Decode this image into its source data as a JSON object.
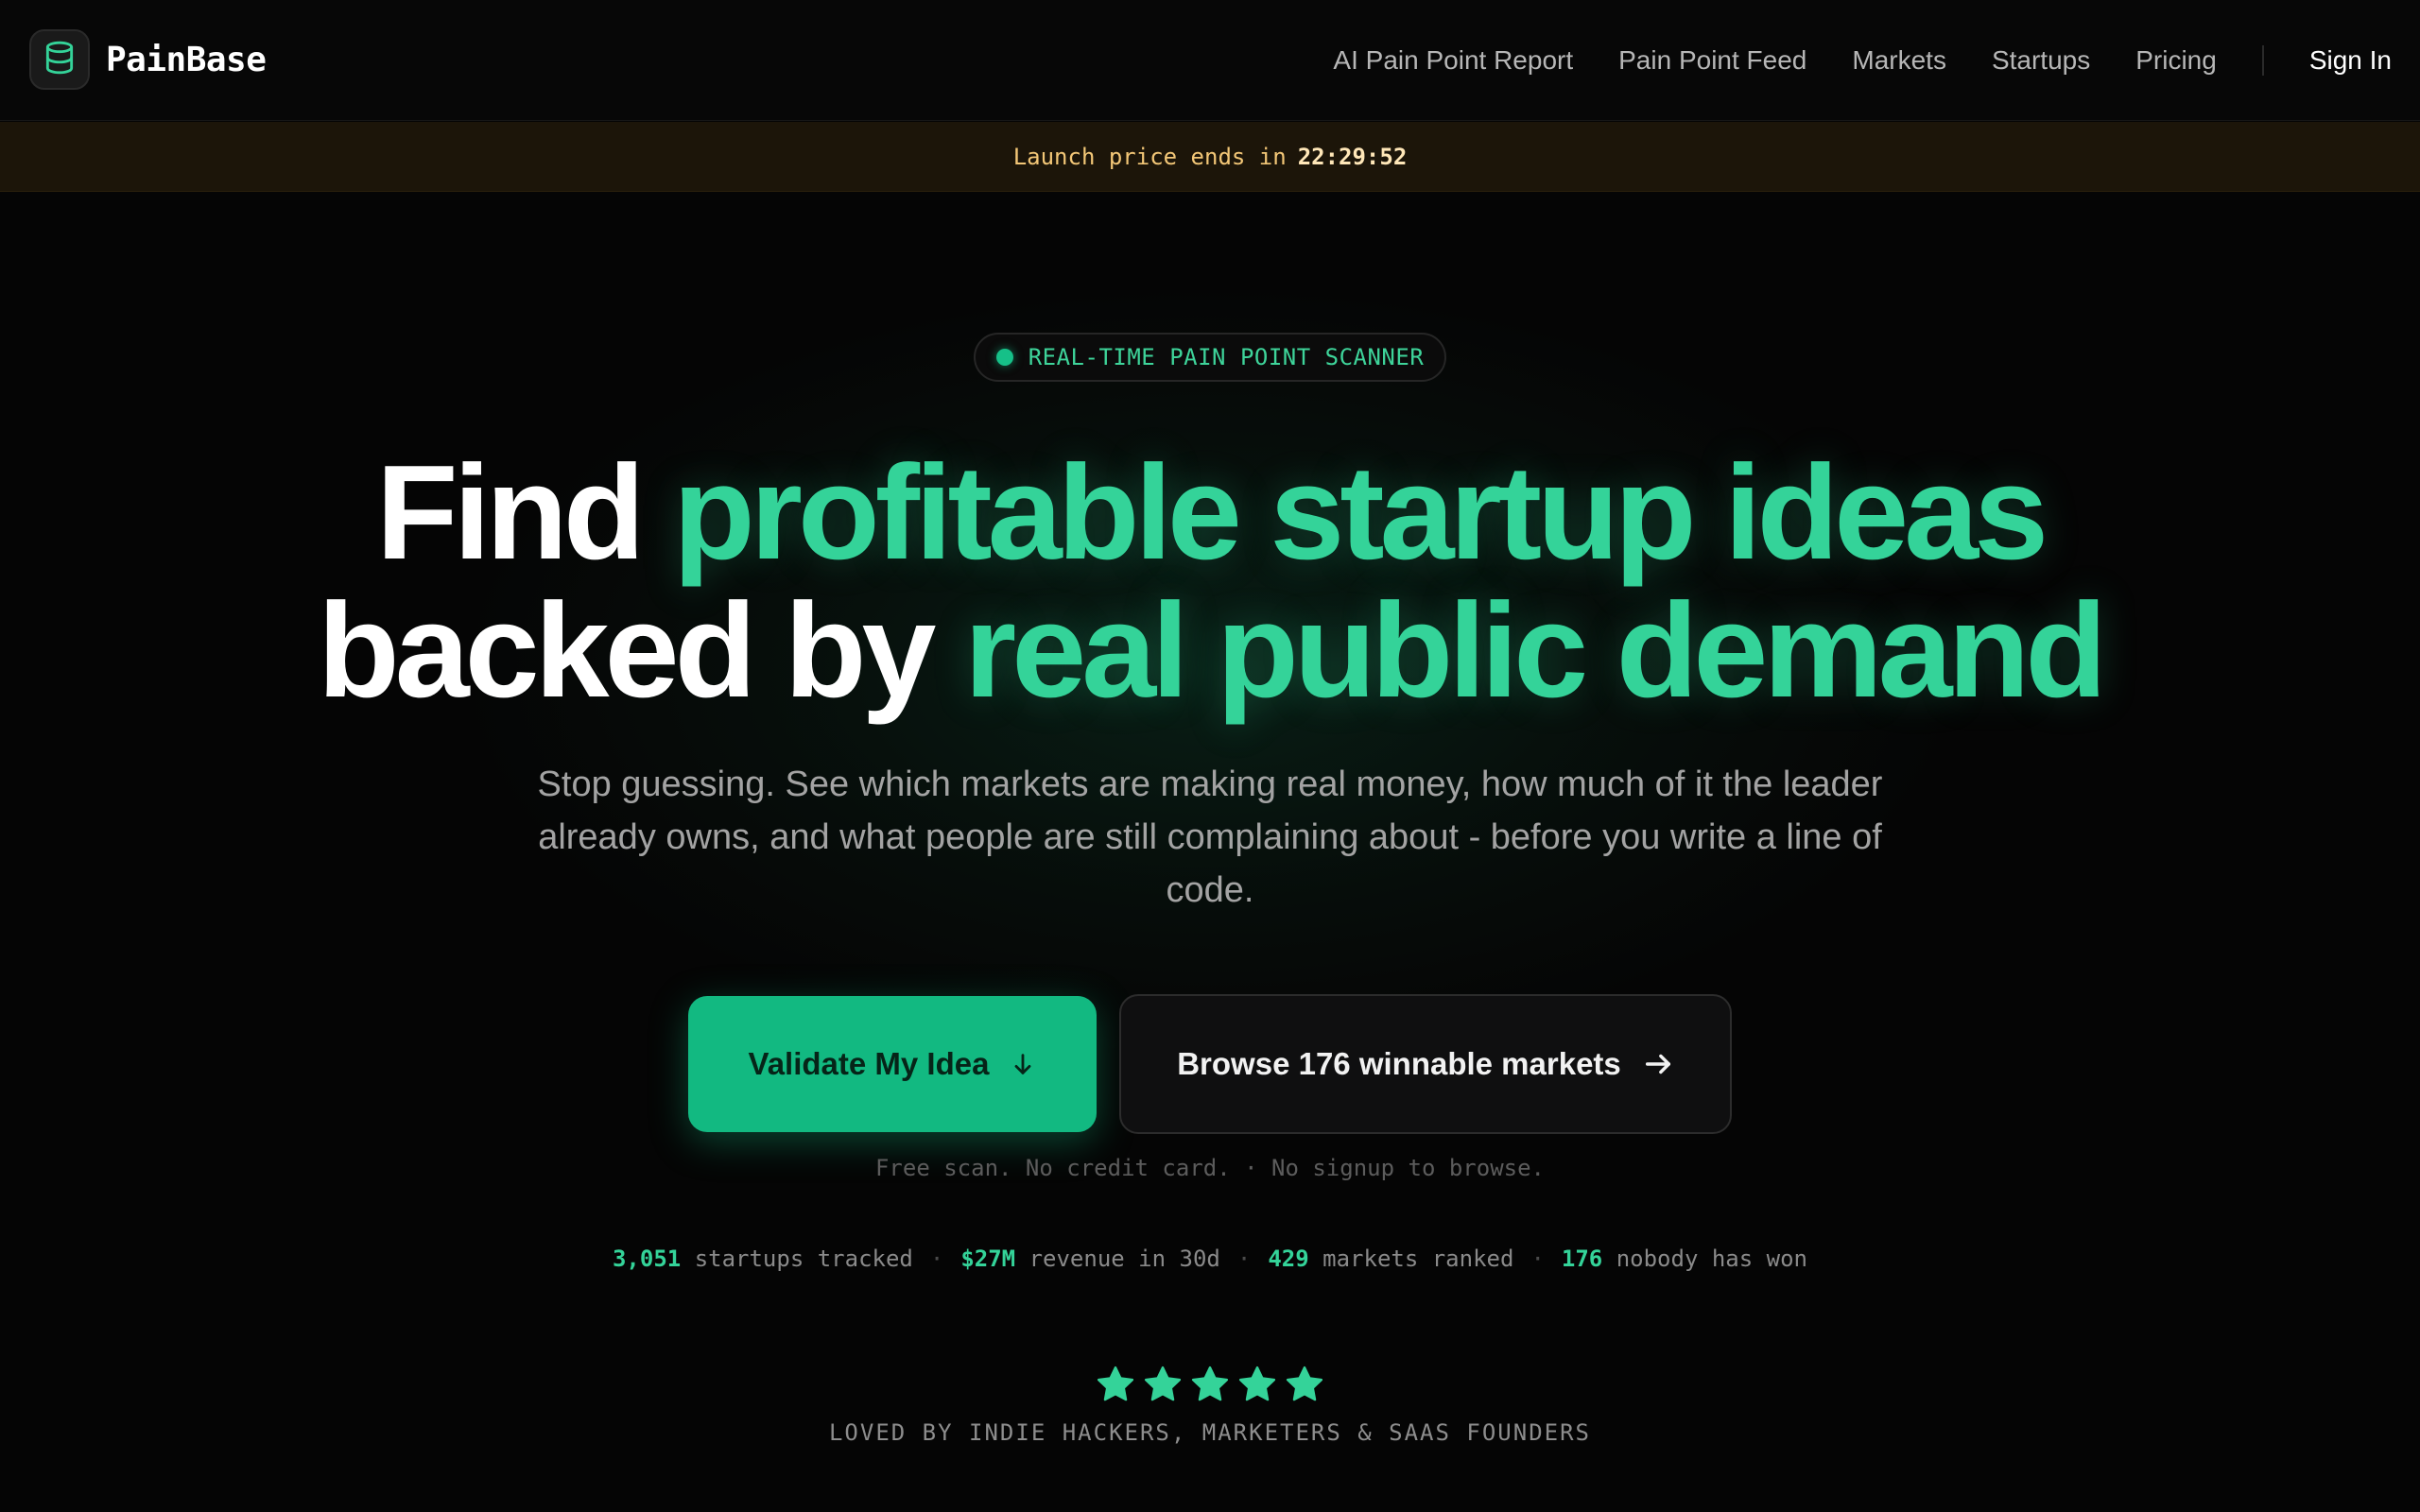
{
  "brand": {
    "name": "PainBase",
    "logo_icon": "database-icon"
  },
  "nav": {
    "links": [
      "AI Pain Point Report",
      "Pain Point Feed",
      "Markets",
      "Startups",
      "Pricing"
    ],
    "signin": "Sign In"
  },
  "banner": {
    "text": "Launch price ends in",
    "timer": "22:29:52"
  },
  "hero": {
    "pill": "REAL-TIME PAIN POINT SCANNER",
    "headline": {
      "line1_white": "Find",
      "line1_green": "profitable startup ideas",
      "line2_white": "backed by",
      "line2_green": "real public demand"
    },
    "subtitle": "Stop guessing. See which markets are making real money, how much of it the leader already owns, and what people are still complaining about - before you write a line of code.",
    "primary_button": "Validate My Idea",
    "secondary_button": "Browse 176 winnable markets",
    "fineprint": "Free scan. No credit card. · No signup to browse."
  },
  "stats": [
    {
      "value": "3,051",
      "label": "startups tracked"
    },
    {
      "value": "$27M",
      "label": "revenue in 30d"
    },
    {
      "value": "429",
      "label": "markets ranked"
    },
    {
      "value": "176",
      "label": "nobody has won"
    }
  ],
  "rating": {
    "stars": 5,
    "text": "LOVED BY INDIE HACKERS, MARKETERS & SAAS FOUNDERS"
  },
  "colors": {
    "accent": "#34d399",
    "button": "#12b981",
    "banner_text": "#f3c777"
  }
}
